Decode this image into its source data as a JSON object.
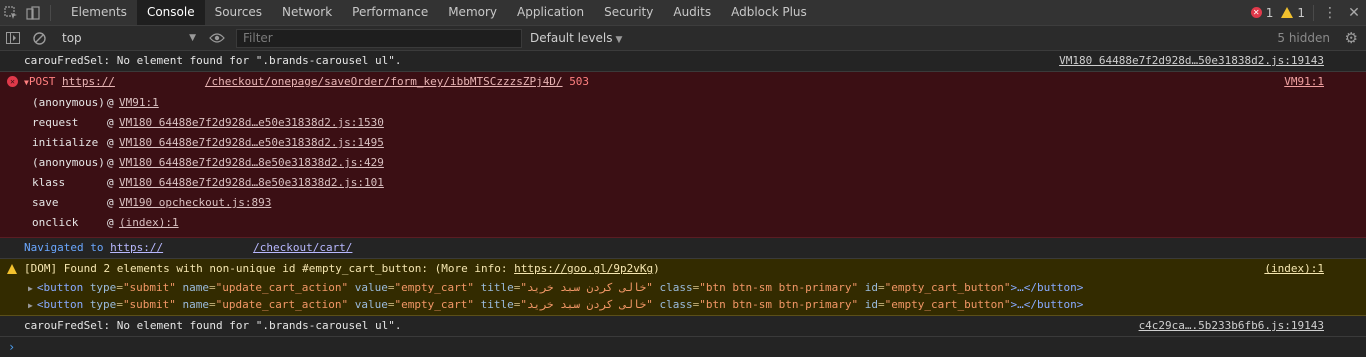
{
  "tabs": [
    "Elements",
    "Console",
    "Sources",
    "Network",
    "Performance",
    "Memory",
    "Application",
    "Security",
    "Audits",
    "Adblock Plus"
  ],
  "active_tab": "Console",
  "counts": {
    "errors": "1",
    "warnings": "1"
  },
  "filterbar": {
    "context": "top",
    "filter_placeholder": "Filter",
    "levels": "Default levels",
    "hidden": "5 hidden"
  },
  "messages": {
    "m1": {
      "text": "carouFredSel: No element found for \".brands-carousel ul\".",
      "source": "VM180 64488e7f2d928d…50e31838d2.js:19143"
    },
    "err": {
      "method": "POST",
      "url_start": "https://",
      "url_path": "/checkout/onepage/saveOrder/form_key/ibbMTSCzzzsZPj4D/",
      "status": "503",
      "source": "VM91:1",
      "stack": [
        {
          "fn": "(anonymous)",
          "loc": "VM91:1"
        },
        {
          "fn": "request",
          "loc": "VM180 64488e7f2d928d…e50e31838d2.js:1530"
        },
        {
          "fn": "initialize",
          "loc": "VM180 64488e7f2d928d…e50e31838d2.js:1495"
        },
        {
          "fn": "(anonymous)",
          "loc": "VM180 64488e7f2d928d…8e50e31838d2.js:429"
        },
        {
          "fn": "klass",
          "loc": "VM180 64488e7f2d928d…8e50e31838d2.js:101"
        },
        {
          "fn": "save",
          "loc": "VM190 opcheckout.js:893"
        },
        {
          "fn": "onclick",
          "loc": "(index):1"
        }
      ]
    },
    "nav": {
      "label": "Navigated to",
      "url_start": "https://",
      "url_path": "/checkout/cart/"
    },
    "warn": {
      "text": "[DOM] Found 2 elements with non-unique id #empty_cart_button: (More info: ",
      "link": "https://goo.gl/9p2vKg",
      "close": ")",
      "source": "(index):1",
      "el_prefix": "<button",
      "attrs": [
        {
          "n": "type",
          "v": "\"submit\""
        },
        {
          "n": "name",
          "v": "\"update_cart_action\""
        },
        {
          "n": "value",
          "v": "\"empty_cart\""
        },
        {
          "n": "title",
          "v": "\"خالی کردن  سبد خرید\""
        },
        {
          "n": "class",
          "v": "\"btn btn-sm  btn-primary\""
        },
        {
          "n": "id",
          "v": "\"empty_cart_button\""
        }
      ],
      "el_suffix": ">…</button>"
    },
    "m2": {
      "text": "carouFredSel: No element found for \".brands-carousel ul\".",
      "source": "c4c29ca….5b233b6fb6.js:19143"
    }
  },
  "prompt": "›",
  "colors": {
    "error_bg": "#3b0f14",
    "warning_bg": "#332b00",
    "link_blue": "#4c9ff2"
  },
  "icons": [
    "inspect-icon",
    "device-toolbar-icon",
    "sidebar-toggle-icon",
    "clear-console-icon",
    "eye-icon",
    "gear-icon",
    "kebab-menu-icon",
    "close-icon"
  ]
}
